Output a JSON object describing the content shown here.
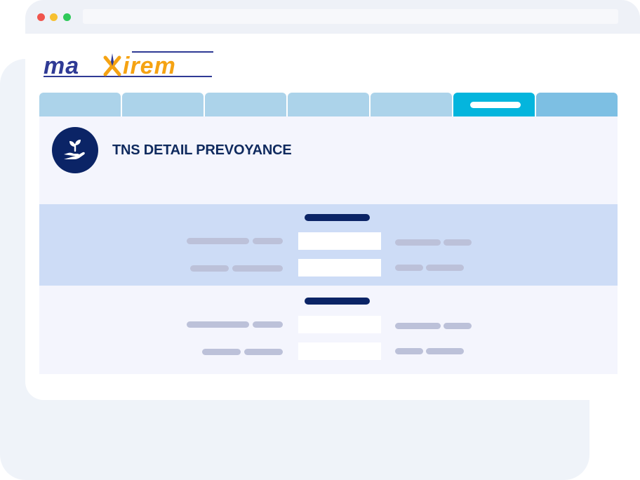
{
  "colors": {
    "window_red": "#f0554d",
    "window_yellow": "#f7c030",
    "window_green": "#2fc95a",
    "logo_blue": "#2f3a95",
    "logo_orange": "#f5a313",
    "tab": "#acd3ea",
    "tab_active": "#04b5dd",
    "tab_last": "#7dbfe3",
    "title_navy": "#0f2a5e"
  },
  "logo": {
    "text": "maxirem"
  },
  "page": {
    "icon": "hand-with-sprout-icon",
    "title": "TNS DETAIL PREVOYANCE"
  },
  "tabs": {
    "count": 7,
    "active_index": 5
  }
}
